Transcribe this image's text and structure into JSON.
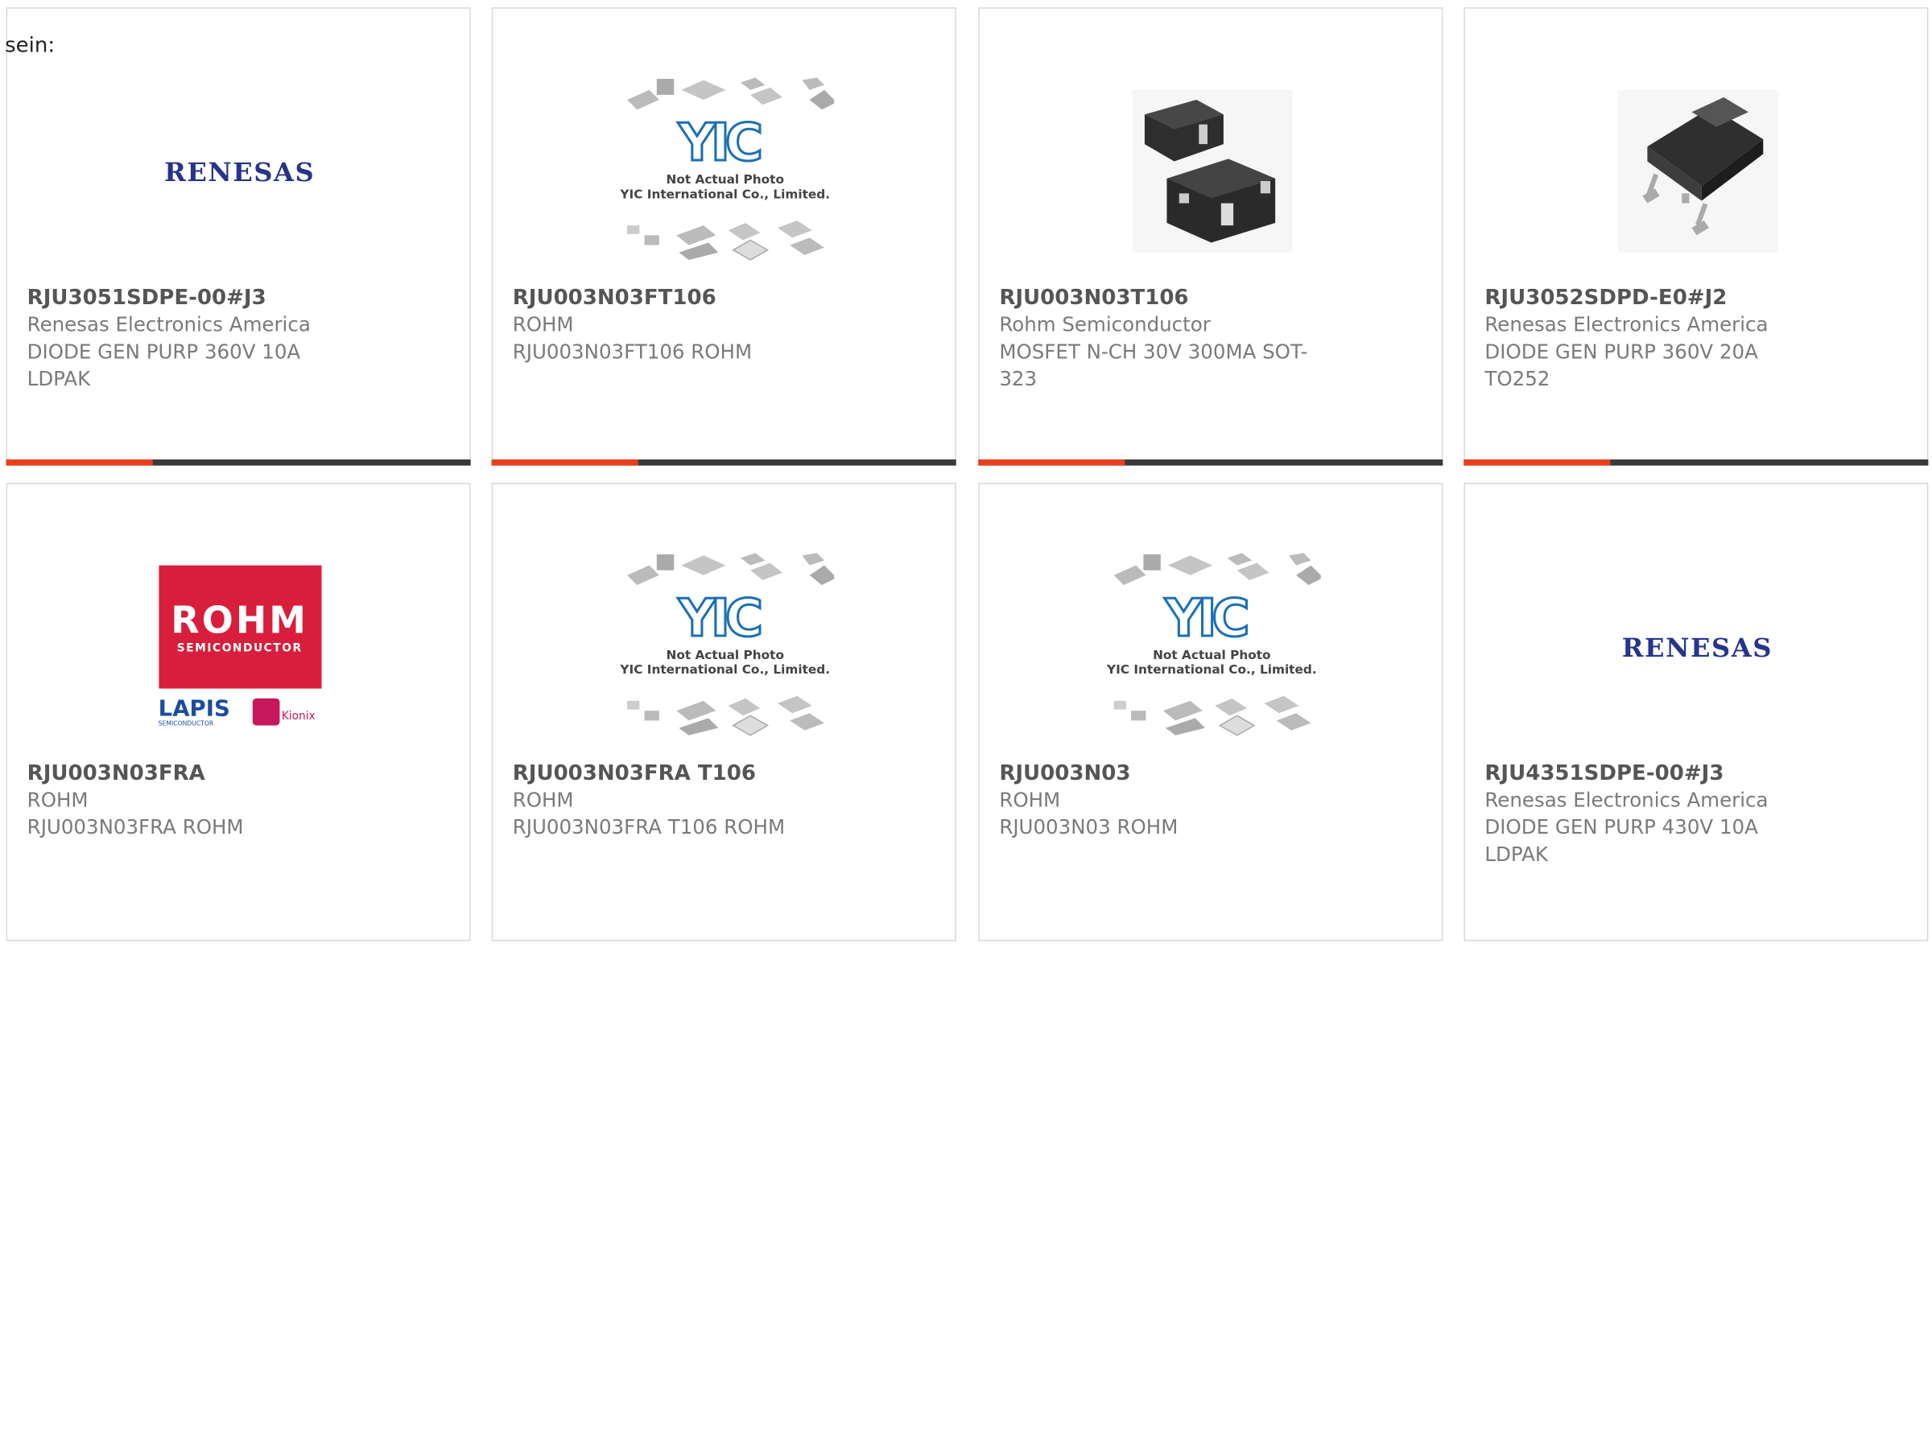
{
  "intro_text": "sein:",
  "products": [
    {
      "part_number": "RJU3051SDPE-00#J3",
      "manufacturer": "Renesas Electronics America",
      "description": "DIODE GEN PURP 360V 10A LDPAK",
      "image": "renesas-logo",
      "logo_text": "RENESAS"
    },
    {
      "part_number": "RJU003N03FT106",
      "manufacturer": "ROHM",
      "description": "RJU003N03FT106 ROHM",
      "image": "yic-placeholder",
      "placeholder_line1": "Not Actual Photo",
      "placeholder_line2": "YIC International Co., Limited."
    },
    {
      "part_number": "RJU003N03T106",
      "manufacturer": "Rohm Semiconductor",
      "description": "MOSFET N-CH 30V 300MA SOT-323",
      "image": "sot323-photo"
    },
    {
      "part_number": "RJU3052SDPD-E0#J2",
      "manufacturer": "Renesas Electronics America",
      "description": "DIODE GEN PURP 360V 20A TO252",
      "image": "to252-photo"
    },
    {
      "part_number": "RJU003N03FRA",
      "manufacturer": "ROHM",
      "description": "RJU003N03FRA ROHM",
      "image": "rohm-logo",
      "logo_main": "ROHM",
      "logo_sub": "SEMICONDUCTOR",
      "logo_lapis": "LAPIS",
      "logo_lapis_sub": "SEMICONDUCTOR",
      "logo_kionix": "Kionix"
    },
    {
      "part_number": "RJU003N03FRA T106",
      "manufacturer": "ROHM",
      "description": "RJU003N03FRA T106 ROHM",
      "image": "yic-placeholder",
      "placeholder_line1": "Not Actual Photo",
      "placeholder_line2": "YIC International Co., Limited."
    },
    {
      "part_number": "RJU003N03",
      "manufacturer": "ROHM",
      "description": "RJU003N03 ROHM",
      "image": "yic-placeholder",
      "placeholder_line1": "Not Actual Photo",
      "placeholder_line2": "YIC International Co., Limited."
    },
    {
      "part_number": "RJU4351SDPE-00#J3",
      "manufacturer": "Renesas Electronics America",
      "description": "DIODE GEN PURP 430V 10A LDPAK",
      "image": "renesas-logo",
      "logo_text": "RENESAS"
    }
  ],
  "colors": {
    "accent": "#e8401c",
    "bar": "#3a3a3a",
    "renesas_blue": "#26348b",
    "rohm_red": "#d81e3c",
    "yic_blue": "#1c6fb5"
  }
}
